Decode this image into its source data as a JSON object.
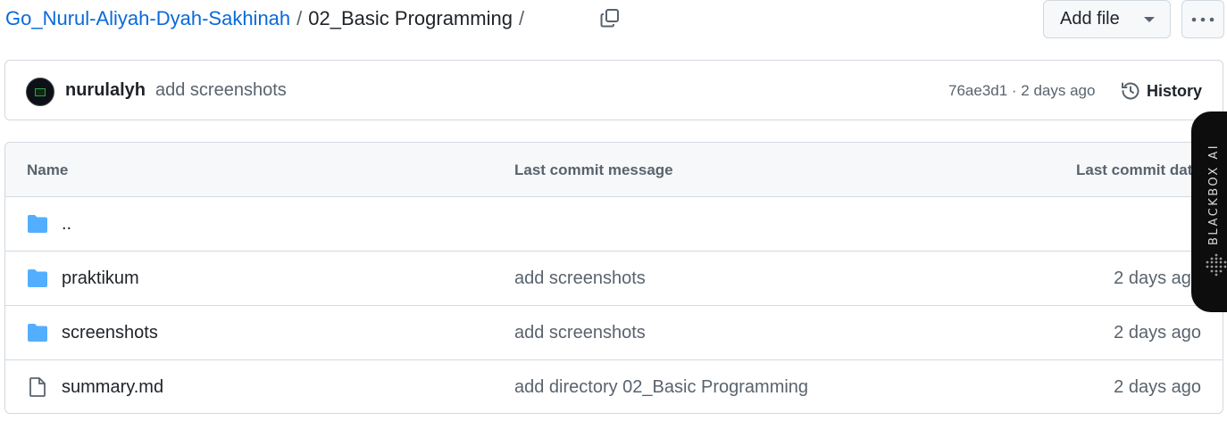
{
  "breadcrumb": {
    "repo": "Go_Nurul-Aliyah-Dyah-Sakhinah",
    "separator": "/",
    "folder": "02_Basic Programming",
    "trailing_separator": "/"
  },
  "actions": {
    "add_file_label": "Add file",
    "more_label": "···"
  },
  "commit": {
    "user": "nurulalyh",
    "message": "add screenshots",
    "meta": "76ae3d1 · 2 days ago",
    "history_label": "History"
  },
  "table": {
    "headers": {
      "name": "Name",
      "message": "Last commit message",
      "date": "Last commit date"
    },
    "parent": "..",
    "rows": [
      {
        "type": "folder",
        "name": "praktikum",
        "message": "add screenshots",
        "date": "2 days ago"
      },
      {
        "type": "folder",
        "name": "screenshots",
        "message": "add screenshots",
        "date": "2 days ago"
      },
      {
        "type": "file",
        "name": "summary.md",
        "message": "add directory 02_Basic Programming",
        "date": "2 days ago"
      }
    ]
  },
  "blackbox": {
    "label": "BLACKBOX AI"
  },
  "icons": {
    "copy": "copy-icon",
    "folder": "folder-icon",
    "file": "file-icon",
    "history": "history-icon",
    "caret": "triangle-down-icon"
  },
  "colors": {
    "link": "#0969da",
    "folder": "#54aeff",
    "muted": "#59636e",
    "border": "#d1d9e0"
  }
}
